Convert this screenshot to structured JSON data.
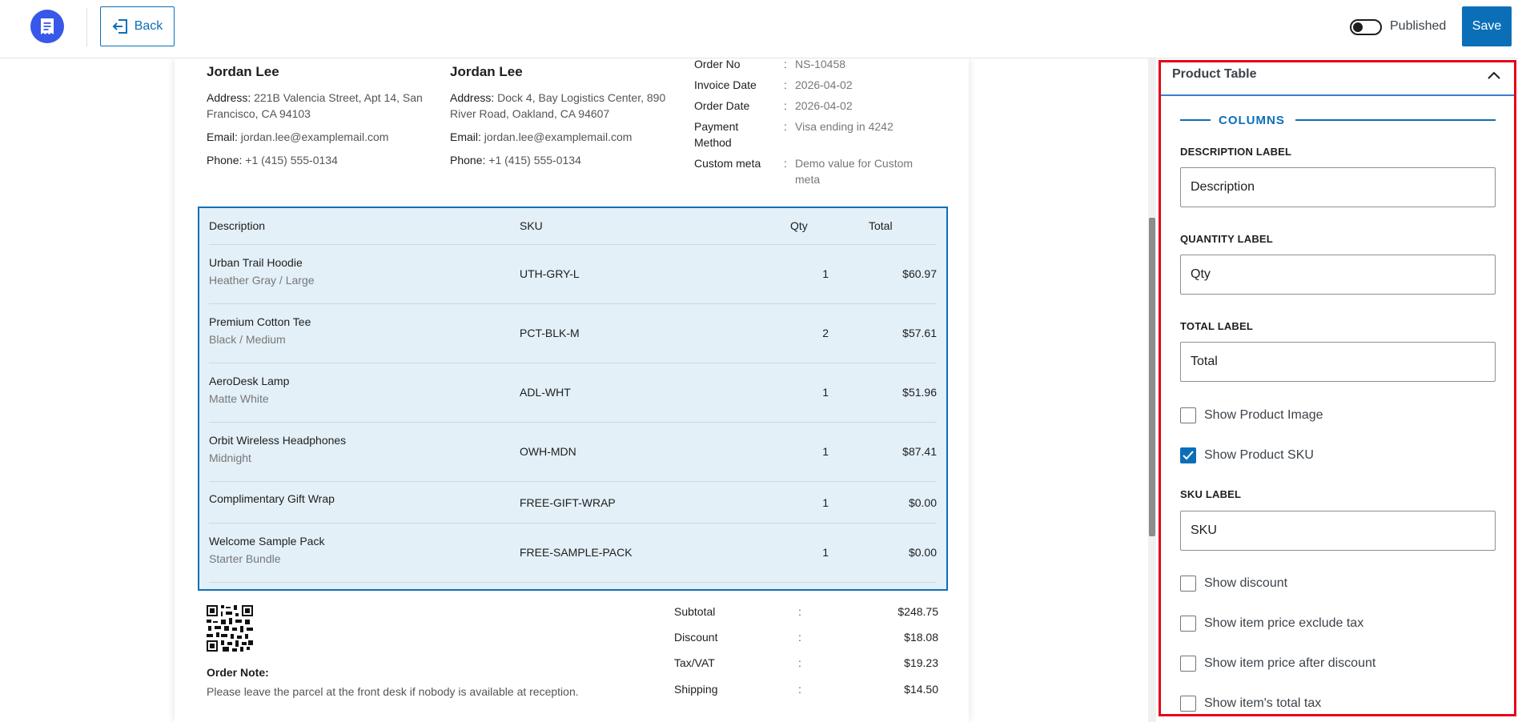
{
  "header": {
    "back_label": "Back",
    "published_label": "Published",
    "save_label": "Save"
  },
  "billing": {
    "name": "Jordan Lee",
    "address_label": "Address:",
    "address": "221B Valencia Street, Apt 14, San Francisco, CA 94103",
    "email_label": "Email:",
    "email": "jordan.lee@examplemail.com",
    "phone_label": "Phone:",
    "phone": "+1 (415) 555-0134"
  },
  "shipping": {
    "name": "Jordan Lee",
    "address_label": "Address:",
    "address": "Dock 4, Bay Logistics Center, 890 River Road, Oakland, CA 94607",
    "email_label": "Email:",
    "email": "jordan.lee@examplemail.com",
    "phone_label": "Phone:",
    "phone": "+1 (415) 555-0134"
  },
  "meta": [
    {
      "key": "Order No",
      "value": "NS-10458"
    },
    {
      "key": "Invoice Date",
      "value": "2026-04-02"
    },
    {
      "key": "Order Date",
      "value": "2026-04-02"
    },
    {
      "key": "Payment Method",
      "value": "Visa ending in 4242"
    },
    {
      "key": "Custom meta",
      "value": "Demo value for Custom meta"
    }
  ],
  "product_table": {
    "headers": {
      "description": "Description",
      "sku": "SKU",
      "qty": "Qty",
      "total": "Total"
    },
    "rows": [
      {
        "name": "Urban Trail Hoodie",
        "variant": "Heather Gray / Large",
        "sku": "UTH-GRY-L",
        "qty": "1",
        "total": "$60.97"
      },
      {
        "name": "Premium Cotton Tee",
        "variant": "Black / Medium",
        "sku": "PCT-BLK-M",
        "qty": "2",
        "total": "$57.61"
      },
      {
        "name": "AeroDesk Lamp",
        "variant": "Matte White",
        "sku": "ADL-WHT",
        "qty": "1",
        "total": "$51.96"
      },
      {
        "name": "Orbit Wireless Headphones",
        "variant": "Midnight",
        "sku": "OWH-MDN",
        "qty": "1",
        "total": "$87.41"
      },
      {
        "name": "Complimentary Gift Wrap",
        "variant": "",
        "sku": "FREE-GIFT-WRAP",
        "qty": "1",
        "total": "$0.00"
      },
      {
        "name": "Welcome Sample Pack",
        "variant": "Starter Bundle",
        "sku": "FREE-SAMPLE-PACK",
        "qty": "1",
        "total": "$0.00"
      }
    ]
  },
  "order_note": {
    "title": "Order Note:",
    "text": "Please leave the parcel at the front desk if nobody is available at reception."
  },
  "totals": [
    {
      "key": "Subtotal",
      "value": "$248.75"
    },
    {
      "key": "Discount",
      "value": "$18.08"
    },
    {
      "key": "Tax/VAT",
      "value": "$19.23"
    },
    {
      "key": "Shipping",
      "value": "$14.50"
    }
  ],
  "panel": {
    "title": "Product Table",
    "section": "COLUMNS",
    "description_label": "DESCRIPTION LABEL",
    "description_value": "Description",
    "quantity_label": "QUANTITY LABEL",
    "quantity_value": "Qty",
    "total_label": "TOTAL LABEL",
    "total_value": "Total",
    "show_product_image": "Show Product Image",
    "show_product_sku": "Show Product SKU",
    "sku_label": "SKU LABEL",
    "sku_value": "SKU",
    "show_discount": "Show discount",
    "show_price_ex_tax": "Show item price exclude tax",
    "show_price_after_discount": "Show item price after discount",
    "show_item_total_tax": "Show item's total tax"
  },
  "colors": {
    "accent": "#0b6fb8",
    "highlight": "#e5001a",
    "table_bg": "#e3f0f7"
  }
}
